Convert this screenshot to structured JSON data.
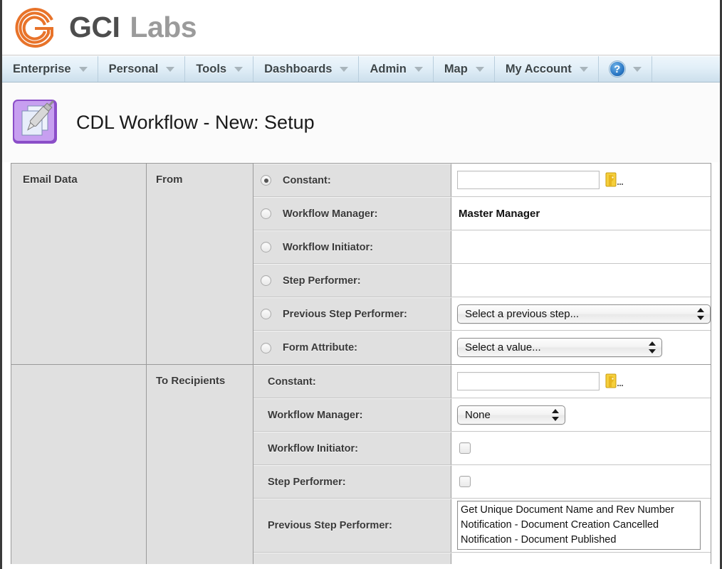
{
  "brand": {
    "logo_icon": "gci-concentric-g-logo",
    "name_primary": "GCI",
    "name_secondary": "Labs",
    "color_primary": "#4d4d4d",
    "color_secondary": "#9b9b9b",
    "logo_color": "#e8732a"
  },
  "nav": {
    "items": [
      {
        "label": "Enterprise",
        "icon": "chevron-down-icon"
      },
      {
        "label": "Personal",
        "icon": "chevron-down-icon"
      },
      {
        "label": "Tools",
        "icon": "chevron-down-icon"
      },
      {
        "label": "Dashboards",
        "icon": "chevron-down-icon"
      },
      {
        "label": "Admin",
        "icon": "chevron-down-icon"
      },
      {
        "label": "Map",
        "icon": "chevron-down-icon"
      },
      {
        "label": "My Account",
        "icon": "chevron-down-icon"
      }
    ],
    "help": {
      "label": "?",
      "icon": "help-circle-icon"
    }
  },
  "header": {
    "icon": "workflow-document-pen-icon",
    "title": "CDL Workflow - New: Setup"
  },
  "form": {
    "group_label": "Email Data",
    "sections": [
      {
        "label": "From",
        "rows": [
          {
            "name": "Constant:",
            "control": "text-with-picker",
            "value": "",
            "picker_icon": "contact-card-icon",
            "selected": true
          },
          {
            "name": "Workflow Manager:",
            "control": "static-text",
            "value": "Master Manager",
            "selected": false
          },
          {
            "name": "Workflow Initiator:",
            "control": "empty",
            "value": "",
            "selected": false
          },
          {
            "name": "Step Performer:",
            "control": "empty",
            "value": "",
            "selected": false
          },
          {
            "name": "Previous Step Performer:",
            "control": "select",
            "value": "Select a previous step...",
            "selected": false
          },
          {
            "name": "Form Attribute:",
            "control": "select",
            "value": "Select a value...",
            "selected": false
          }
        ]
      },
      {
        "label": "To Recipients",
        "rows": [
          {
            "name": "Constant:",
            "control": "text-with-picker",
            "value": "",
            "picker_icon": "contact-card-icon"
          },
          {
            "name": "Workflow Manager:",
            "control": "select",
            "value": "None"
          },
          {
            "name": "Workflow Initiator:",
            "control": "checkbox",
            "checked": false
          },
          {
            "name": "Step Performer:",
            "control": "checkbox",
            "checked": false
          },
          {
            "name": "Previous Step Performer:",
            "control": "listbox",
            "options": [
              "Get Unique Document Name and Rev Number",
              "Notification - Document Creation Cancelled",
              "Notification - Document Published"
            ]
          }
        ]
      }
    ]
  }
}
